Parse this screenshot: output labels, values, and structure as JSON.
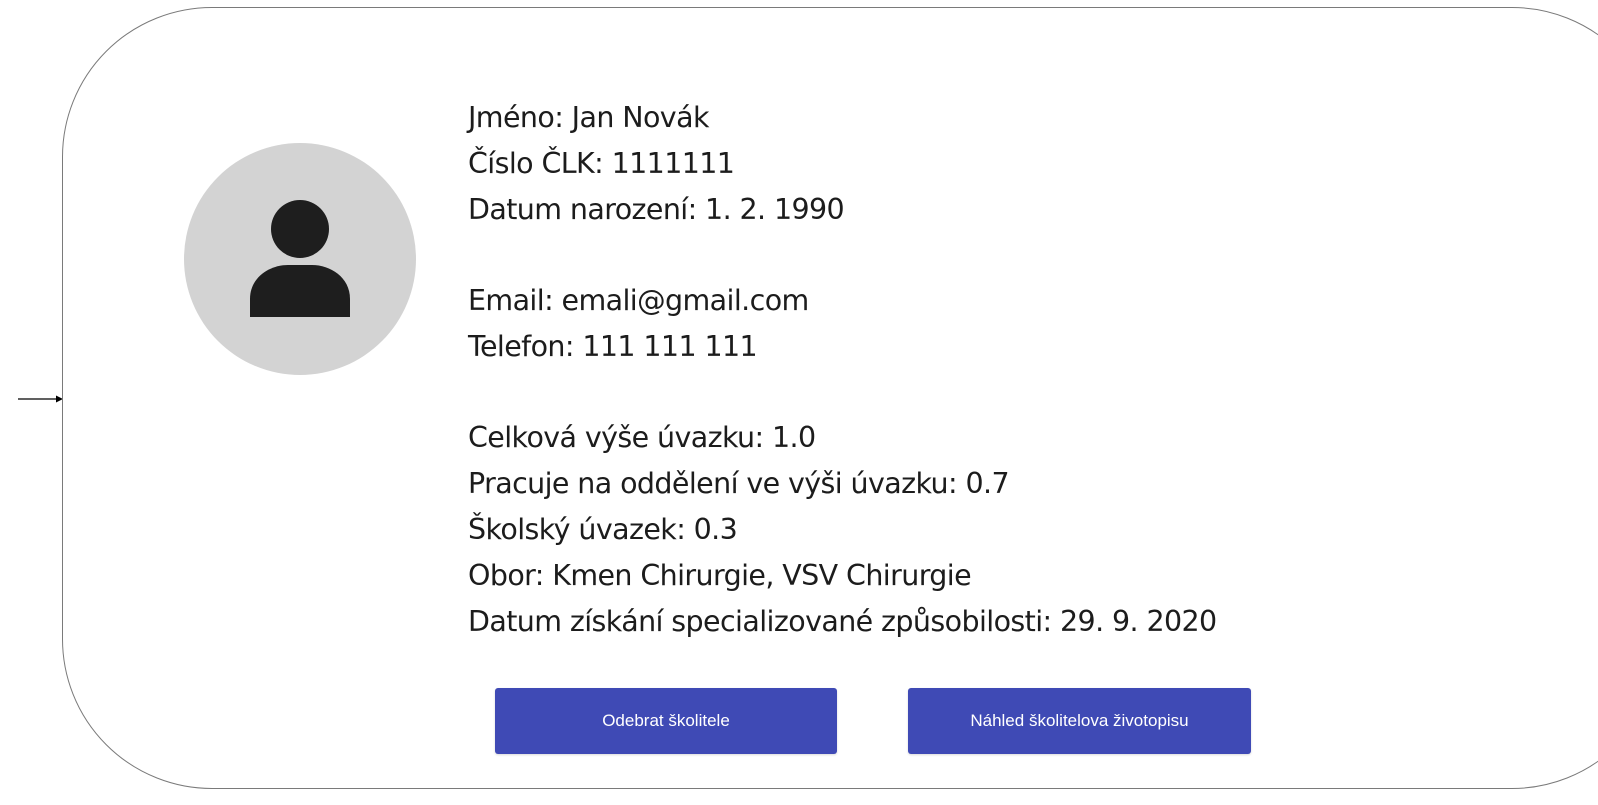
{
  "colors": {
    "button_bg": "#3f4ab5",
    "button_text": "#ffffff",
    "avatar_bg": "#d3d3d3",
    "avatar_icon": "#1e1e1e",
    "card_border": "#7a7a7a",
    "text": "#1c1c1c"
  },
  "icons": {
    "incoming_arrow": "arrow-right-icon",
    "avatar": "user-icon"
  },
  "profile": {
    "name_line": "Jméno: Jan Novák",
    "clk_line": "Číslo ČLK: 1111111",
    "birth_line": "Datum narození: 1. 2. 1990",
    "email_line": "Email: emali@gmail.com",
    "phone_line": "Telefon: 111 111 111",
    "total_workload_line": "Celková výše úvazku: 1.0",
    "department_workload_line": "Pracuje na oddělení ve výši úvazku: 0.7",
    "training_workload_line": "Školský úvazek: 0.3",
    "field_line": "Obor: Kmen Chirurgie, VSV Chirurgie",
    "specialization_date_line": "Datum získání specializované způsobilosti: 29. 9. 2020"
  },
  "actions": {
    "remove_label": "Odebrat školitele",
    "cv_preview_label": "Náhled školitelova životopisu"
  }
}
